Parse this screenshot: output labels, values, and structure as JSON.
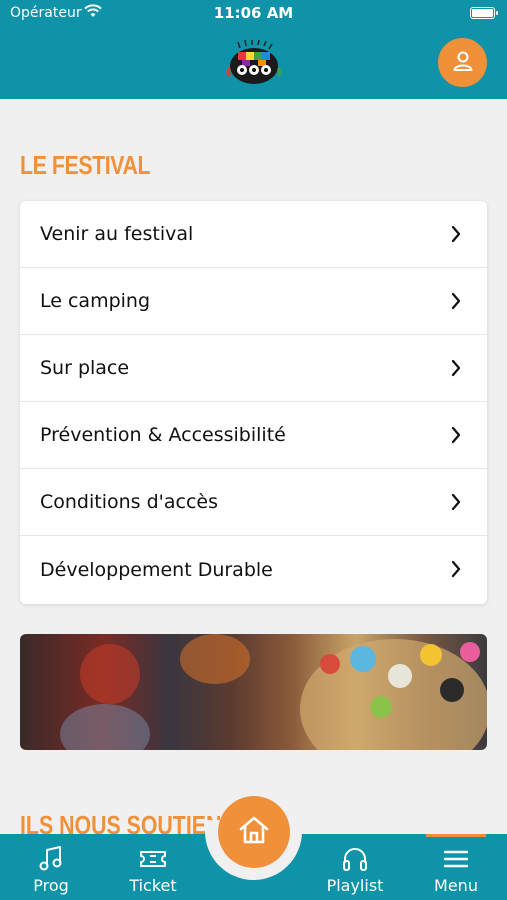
{
  "status_bar": {
    "carrier": "Opérateur",
    "time": "11:06 AM"
  },
  "header": {
    "logo_icon": "festival-logo",
    "profile_icon": "user-icon"
  },
  "festival_section": {
    "title": "LE FESTIVAL",
    "items": [
      {
        "label": "Venir au festival"
      },
      {
        "label": "Le camping"
      },
      {
        "label": "Sur place"
      },
      {
        "label": "Prévention & Accessibilité"
      },
      {
        "label": "Conditions d'accès"
      },
      {
        "label": "Développement Durable"
      }
    ]
  },
  "sponsors_section": {
    "title": "ILS NOUS SOUTIENNENT"
  },
  "tab_bar": {
    "tabs": [
      {
        "label": "Prog",
        "icon": "music-note-icon"
      },
      {
        "label": "Ticket",
        "icon": "ticket-icon"
      },
      {
        "label": "Playlist",
        "icon": "headphones-icon"
      },
      {
        "label": "Menu",
        "icon": "hamburger-menu-icon"
      }
    ],
    "home_icon": "home-icon",
    "active_tab": "Menu"
  },
  "colors": {
    "brand_teal": "#0e93a8",
    "accent_orange": "#f0913a",
    "background": "#f0f0f0"
  }
}
